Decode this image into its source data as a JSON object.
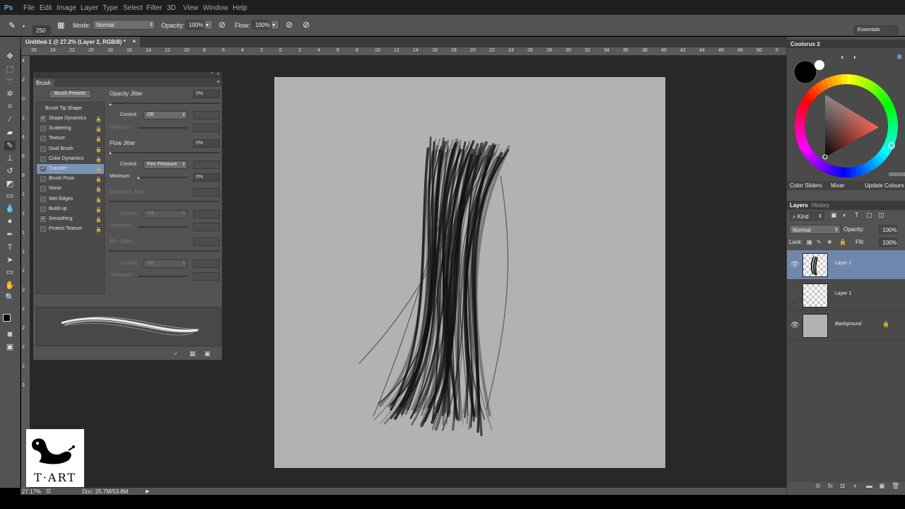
{
  "menubar": {
    "app_logo": "Ps",
    "items": [
      "File",
      "Edit",
      "Image",
      "Layer",
      "Type",
      "Select",
      "Filter",
      "3D",
      "View",
      "Window",
      "Help"
    ]
  },
  "options_bar": {
    "brush_size": "250",
    "mode_label": "Mode:",
    "mode_value": "Normal",
    "opacity_label": "Opacity:",
    "opacity_value": "100%",
    "flow_label": "Flow:",
    "flow_value": "100%",
    "workspace": "Essentials"
  },
  "document": {
    "tab_title": "Untitled-1 @ 27.2% (Layer 2, RGB/8) *",
    "ruler_top": [
      "26",
      "24",
      "22",
      "20",
      "18",
      "16",
      "14",
      "12",
      "10",
      "8",
      "6",
      "4",
      "2",
      "0",
      "2",
      "4",
      "6",
      "8",
      "10",
      "12",
      "14",
      "16",
      "18",
      "20",
      "22",
      "24",
      "26",
      "28",
      "30",
      "32",
      "34",
      "36",
      "38",
      "40",
      "42",
      "44",
      "46",
      "48",
      "50",
      "5"
    ],
    "ruler_left": [
      "4",
      "2",
      "0",
      "2",
      "4",
      "6",
      "8",
      "1",
      "1",
      "1",
      "1",
      "1",
      "2",
      "2",
      "2",
      "2",
      "2",
      "3"
    ]
  },
  "status": {
    "zoom": "27.17%",
    "doc": "Doc: 25.7M/53.8M"
  },
  "brush_panel": {
    "tab": "Brush",
    "presets_button": "Brush Presets",
    "tip_shape": "Brush Tip Shape",
    "options": [
      {
        "label": "Shape Dynamics",
        "checked": true
      },
      {
        "label": "Scattering",
        "checked": false
      },
      {
        "label": "Texture",
        "checked": false
      },
      {
        "label": "Dual Brush",
        "checked": false
      },
      {
        "label": "Color Dynamics",
        "checked": false
      },
      {
        "label": "Transfer",
        "checked": true
      },
      {
        "label": "Brush Pose",
        "checked": false
      },
      {
        "label": "Noise",
        "checked": false
      },
      {
        "label": "Wet Edges",
        "checked": false
      },
      {
        "label": "Build-up",
        "checked": false
      },
      {
        "label": "Smoothing",
        "checked": true
      },
      {
        "label": "Protect Texture",
        "checked": false
      }
    ],
    "opacity_jitter": {
      "label": "Opacity Jitter",
      "value": "0%"
    },
    "control_label": "Control:",
    "opacity_control": "Off",
    "minimum_label": "Minimum",
    "flow_jitter": {
      "label": "Flow Jitter",
      "value": "0%"
    },
    "flow_control": "Pen Pressure",
    "flow_minimum": "0%",
    "wetness_jitter": "Wetness Jitter",
    "wetness_control": "Off",
    "mix_jitter": "Mix Jitter",
    "mix_control": "Off"
  },
  "color_panel": {
    "title": "Coolorus 2",
    "hex_value": "000000",
    "tabs": [
      "Color Sliders",
      "Mixer"
    ],
    "update_label": "Update Colours"
  },
  "layers_panel": {
    "tabs": [
      "Layers",
      "History"
    ],
    "filter": "Kind",
    "blend_mode": "Normal",
    "opacity_label": "Opacity:",
    "opacity_value": "100%",
    "lock_label": "Lock:",
    "fill_label": "Fill:",
    "fill_value": "100%",
    "layers": [
      {
        "name": "Layer 2",
        "visible": true,
        "selected": true
      },
      {
        "name": "Layer 1",
        "visible": false,
        "selected": false
      },
      {
        "name": "Background",
        "visible": true,
        "selected": false,
        "locked": true
      }
    ]
  },
  "watermark": {
    "text": "T·ART"
  },
  "colors": {
    "ui_bg": "#535353",
    "workspace": "#282828",
    "canvas": "#b2b2b2",
    "selection": "#7892b8"
  }
}
